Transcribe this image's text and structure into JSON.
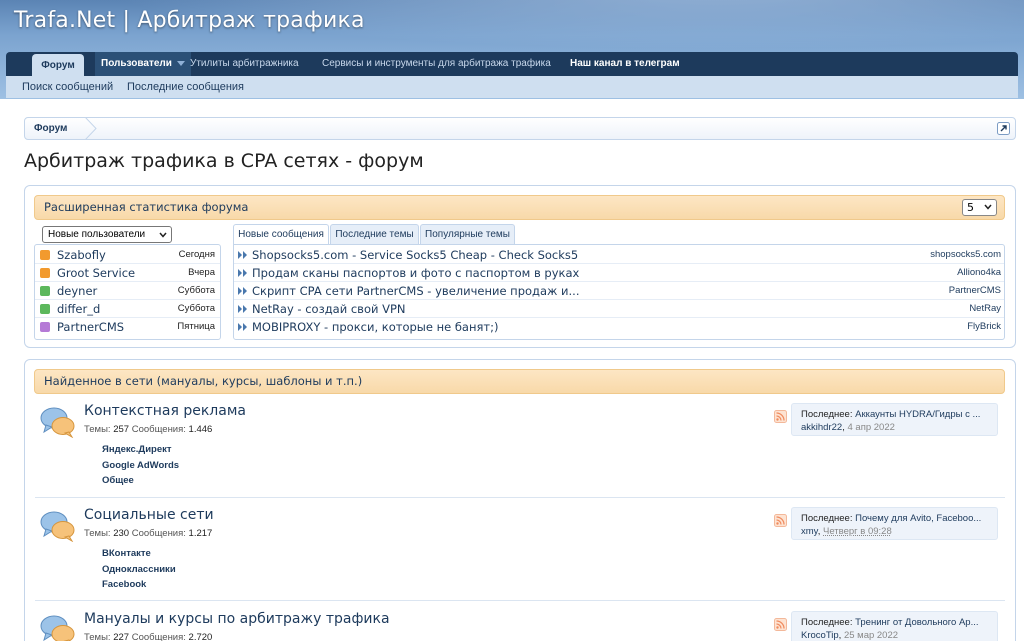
{
  "site": {
    "title": "Trafa.Net | Арбитраж трафика"
  },
  "nav": {
    "tabs": [
      {
        "label": "Форум"
      },
      {
        "label": "Пользователи"
      },
      {
        "label": "Утилиты арбитражника"
      },
      {
        "label": "Сервисы и инструменты для арбитража трафика"
      },
      {
        "label": "Наш канал в телеграм"
      }
    ],
    "subnav": [
      {
        "label": "Поиск сообщений"
      },
      {
        "label": "Последние сообщения"
      }
    ]
  },
  "breadcrumb": {
    "label": "Форум"
  },
  "page": {
    "title": "Арбитраж трафика в CPA сетях - форум"
  },
  "stats": {
    "header": "Расширенная статистика форума",
    "count_select": "5",
    "users_select": "Новые пользователи",
    "users": [
      {
        "name": "Szabofly",
        "date": "Сегодня",
        "color": "#f29a2e"
      },
      {
        "name": "Groot Service",
        "date": "Вчера",
        "color": "#f29a2e"
      },
      {
        "name": "deyner",
        "date": "Суббота",
        "color": "#5cb85c"
      },
      {
        "name": "differ_d",
        "date": "Суббота",
        "color": "#5cb85c"
      },
      {
        "name": "PartnerCMS",
        "date": "Пятница",
        "color": "#b57ad6"
      }
    ],
    "tabs": [
      {
        "label": "Новые сообщения"
      },
      {
        "label": "Последние темы"
      },
      {
        "label": "Популярные темы"
      }
    ],
    "threads": [
      {
        "title": "Shopsocks5.com - Service Socks5 Cheap - Check Socks5",
        "author": "shopsocks5.com"
      },
      {
        "title": "Продам сканы паспортов и фото с паспортом в руках",
        "author": "Alliono4ka"
      },
      {
        "title": "Скрипт CPA сети PartnerCMS - увеличение продаж и...",
        "author": "PartnerCMS"
      },
      {
        "title": "NetRay - создай свой VPN",
        "author": "NetRay"
      },
      {
        "title": "MOBIPROXY - прокси, которые не банят;)",
        "author": "FlyBrick"
      }
    ]
  },
  "category": {
    "header": "Найденное в сети (мануалы, курсы, шаблоны и т.п.)",
    "forums": [
      {
        "name": "Контекстная реклама",
        "topics_label": "Темы:",
        "topics": "257",
        "messages_label": "Сообщения:",
        "messages": "1.446",
        "subforums": [
          "Яндекс.Директ",
          "Google AdWords",
          "Общее"
        ],
        "last_label": "Последнее:",
        "last_title": "Аккаунты HYDRA/Гидры с ...",
        "last_user": "akkihdr22",
        "last_date": "4 апр 2022"
      },
      {
        "name": "Социальные сети",
        "topics_label": "Темы:",
        "topics": "230",
        "messages_label": "Сообщения:",
        "messages": "1.217",
        "subforums": [
          "ВКонтакте",
          "Одноклассники",
          "Facebook"
        ],
        "last_label": "Последнее:",
        "last_title": "Почему для Avito, Faceboo...",
        "last_user": "xmy",
        "last_date": "Четверг в 09:28"
      },
      {
        "name": "Мануалы и курсы по арбитражу трафика",
        "topics_label": "Темы:",
        "topics": "227",
        "messages_label": "Сообщения:",
        "messages": "2.720",
        "subforums": [],
        "last_label": "Последнее:",
        "last_title": "Тренинг от Довольного Ар...",
        "last_user": "KrocoTip",
        "last_date": "25 мар 2022"
      }
    ]
  }
}
